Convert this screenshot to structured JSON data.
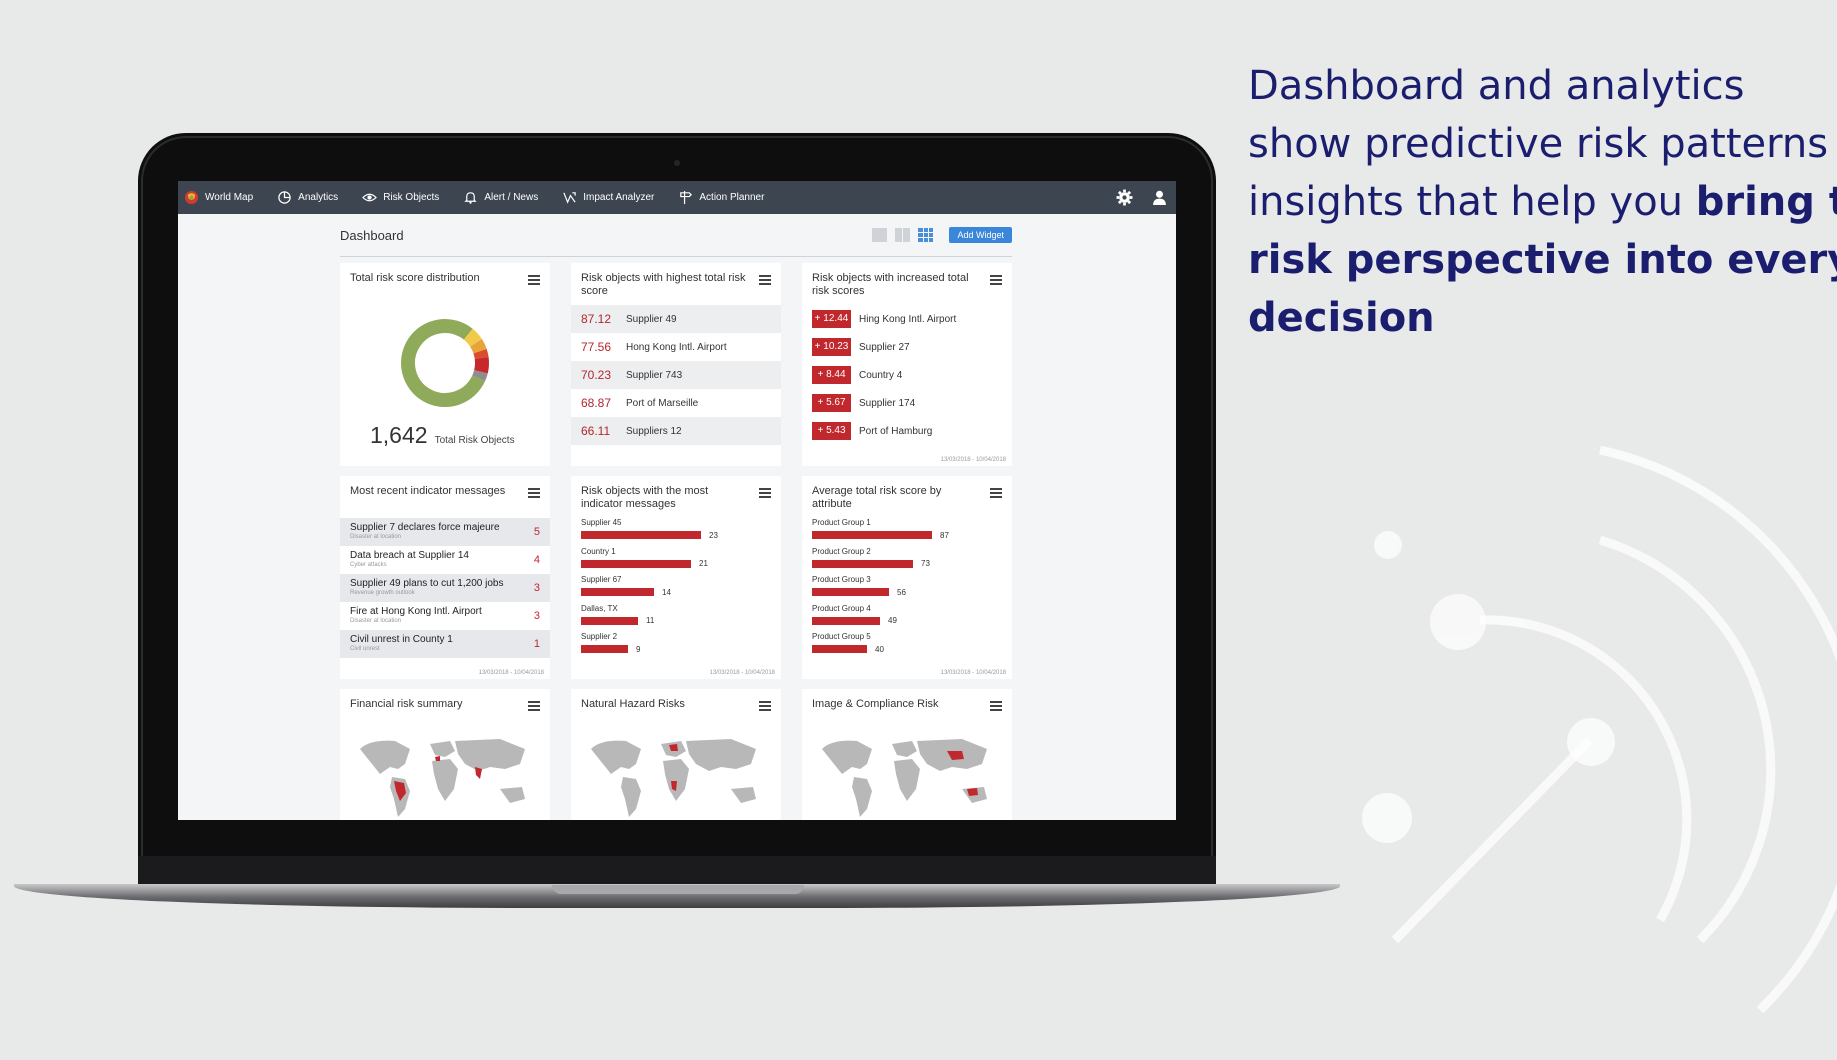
{
  "headline": {
    "line1": "Dashboard and analytics",
    "line2": "show predictive risk patterns and",
    "line3": "insights that help you ",
    "line3_bold": "bring the",
    "line4_bold": "risk perspective into every",
    "line5_bold": "decision"
  },
  "nav": {
    "items": [
      {
        "label": "World Map",
        "icon": "world-map-logo-icon"
      },
      {
        "label": "Analytics",
        "icon": "analytics-icon"
      },
      {
        "label": "Risk Objects",
        "icon": "eye-icon"
      },
      {
        "label": "Alert / News",
        "icon": "bell-icon"
      },
      {
        "label": "Impact Analyzer",
        "icon": "impact-analyzer-icon"
      },
      {
        "label": "Action Planner",
        "icon": "signpost-icon"
      }
    ],
    "right_icons": [
      "gear-icon",
      "user-icon"
    ]
  },
  "dashboard": {
    "title": "Dashboard",
    "add_widget_label": "Add Widget",
    "date_range": "13/03/2018 - 10/04/2018"
  },
  "widgets": {
    "distribution": {
      "title": "Total risk score distribution",
      "total": "1,642",
      "total_label": "Total Risk Objects",
      "segment_colors": [
        "#8faa5a",
        "#f3c94a",
        "#e8a33a",
        "#d84d2e",
        "#c7282e",
        "#8e8e8e"
      ],
      "segment_shares": [
        0.79,
        0.05,
        0.04,
        0.03,
        0.06,
        0.03
      ]
    },
    "highest": {
      "title": "Risk objects with highest total risk score",
      "rows": [
        {
          "value": "87.12",
          "name": "Supplier 49"
        },
        {
          "value": "77.56",
          "name": "Hong Kong Intl. Airport"
        },
        {
          "value": "70.23",
          "name": "Supplier 743"
        },
        {
          "value": "68.87",
          "name": "Port of Marseille"
        },
        {
          "value": "66.11",
          "name": "Suppliers 12"
        }
      ]
    },
    "increased": {
      "title": "Risk objects with increased total risk scores",
      "rows": [
        {
          "value": "+ 12.44",
          "name": "Hing Kong Intl. Airport"
        },
        {
          "value": "+ 10.23",
          "name": "Supplier 27"
        },
        {
          "value": "+ 8.44",
          "name": "Country 4"
        },
        {
          "value": "+ 5.67",
          "name": "Supplier 174"
        },
        {
          "value": "+ 5.43",
          "name": "Port of Hamburg"
        }
      ]
    },
    "messages": {
      "title": "Most recent indicator messages",
      "rows": [
        {
          "text": "Supplier 7 declares force majeure",
          "sub": "Disaster at location",
          "count": "5"
        },
        {
          "text": "Data breach at Supplier 14",
          "sub": "Cyber attacks",
          "count": "4"
        },
        {
          "text": "Supplier 49 plans to cut 1,200 jobs",
          "sub": "Revenue growth outlook",
          "count": "3"
        },
        {
          "text": "Fire at Hong Kong Intl. Airport",
          "sub": "Disaster at location",
          "count": "3"
        },
        {
          "text": "Civil unrest in County 1",
          "sub": "Civil unrest",
          "count": "1"
        }
      ]
    },
    "most_messages": {
      "title": "Risk objects with the most indicator messages",
      "max": 23,
      "rows": [
        {
          "label": "Supplier 45",
          "value": 23
        },
        {
          "label": "Country 1",
          "value": 21
        },
        {
          "label": "Supplier 67",
          "value": 14
        },
        {
          "label": "Dallas, TX",
          "value": 11
        },
        {
          "label": "Supplier 2",
          "value": 9
        }
      ]
    },
    "average": {
      "title": "Average total risk score by attribute",
      "max": 87,
      "rows": [
        {
          "label": "Product Group 1",
          "value": 87
        },
        {
          "label": "Product Group 2",
          "value": 73
        },
        {
          "label": "Product Group 3",
          "value": 56
        },
        {
          "label": "Product Group 4",
          "value": 49
        },
        {
          "label": "Product Group 5",
          "value": 40
        }
      ]
    },
    "financial": {
      "title": "Financial risk summary"
    },
    "natural": {
      "title": "Natural Hazard Risks"
    },
    "compliance": {
      "title": "Image & Compliance Risk"
    }
  },
  "colors": {
    "headline": "#1b1e6e",
    "navbar": "#3d4550",
    "accent_red": "#c0282e",
    "button_blue": "#3a87d9"
  }
}
